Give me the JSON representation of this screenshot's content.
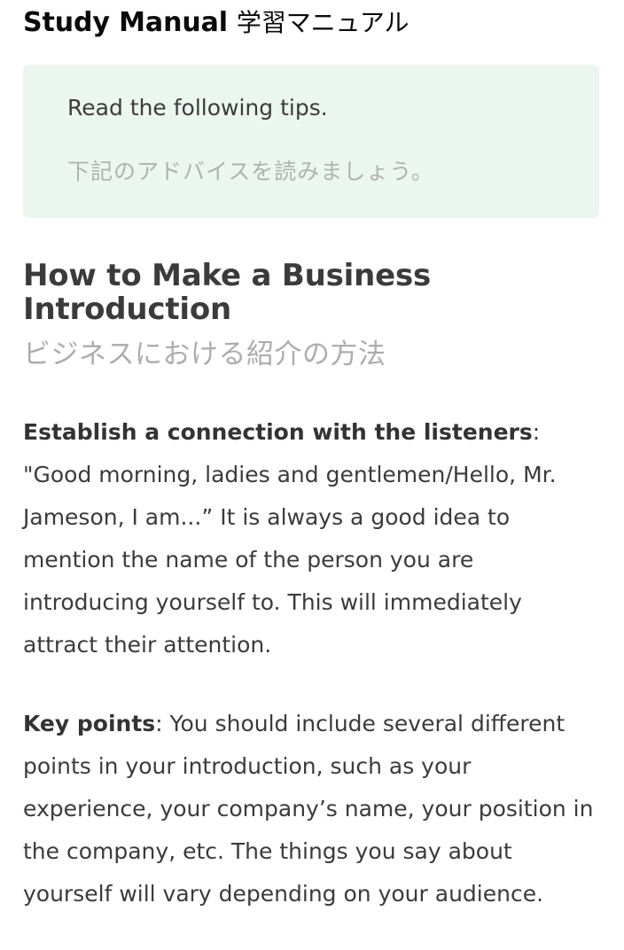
{
  "theme": {
    "page_background": "#ffffff",
    "callout_background": "#ecf6f1",
    "body_text": "#3b3b3b",
    "muted_text": "#adadad",
    "title_text": "#0a0a0a"
  },
  "title": {
    "english": "Study Manual",
    "japanese": "学習マニュアル"
  },
  "callout": {
    "english": "Read the following tips.",
    "japanese": "下記のアドバイスを読みましょう。"
  },
  "section": {
    "heading": "How to Make a Business Introduction",
    "subheading": "ビジネスにおける紹介の方法"
  },
  "paragraphs": [
    {
      "lead": "Establish a connection with the listeners",
      "rest": ": \"Good morning, ladies and gentlemen/Hello, Mr. Jameson, I am...” It is always a good idea to mention the name of the person you are introducing yourself to. This will immediately attract their attention."
    },
    {
      "lead": "Key points",
      "rest": ": You should include several different points in your introduction, such as your experience, your company’s name, your position in the company, etc. The things you say about yourself will vary depending on your audience."
    }
  ]
}
